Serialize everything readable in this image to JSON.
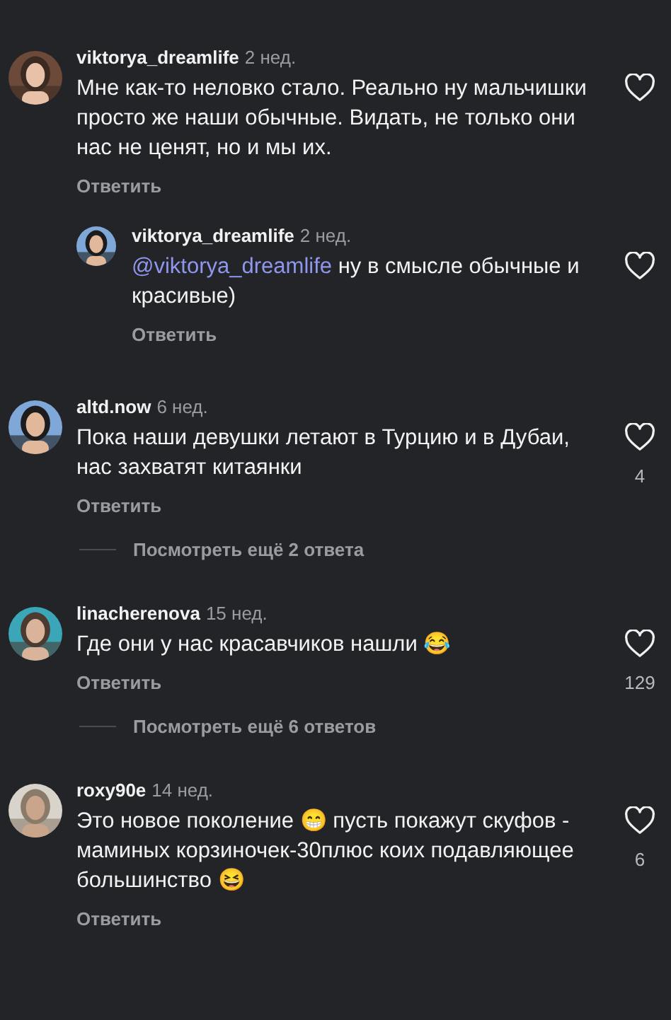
{
  "comments": [
    {
      "username": "viktorya_dreamlife",
      "time": "2 нед.",
      "text": "Мне как-то неловко стало. Реально ну мальчишки просто же наши обычные. Видать, не только они нас не ценят, но и мы их.",
      "reply_label": "Ответить",
      "children": [
        {
          "username": "viktorya_dreamlife",
          "time": "2 нед.",
          "mention": "@viktorya_dreamlife",
          "text": "ну в смысле обычные и красивые)",
          "reply_label": "Ответить"
        }
      ]
    },
    {
      "username": "altd.now",
      "time": "6 нед.",
      "text": "Пока наши девушки летают в Турцию и в Дубаи, нас захватят китаянки",
      "reply_label": "Ответить",
      "likes": "4",
      "more_replies": "Посмотреть ещё 2 ответа"
    },
    {
      "username": "linacherenova",
      "time": "15 нед.",
      "text": "Где они у нас красавчиков нашли 😂",
      "reply_label": "Ответить",
      "likes": "129",
      "more_replies": "Посмотреть ещё 6 ответов"
    },
    {
      "username": "roxy90e",
      "time": "14 нед.",
      "text": "Это новое поколение 😁 пусть покажут скуфов - маминых корзиночек-30плюс коих подавляющее большинство 😆",
      "reply_label": "Ответить",
      "likes": "6"
    }
  ]
}
